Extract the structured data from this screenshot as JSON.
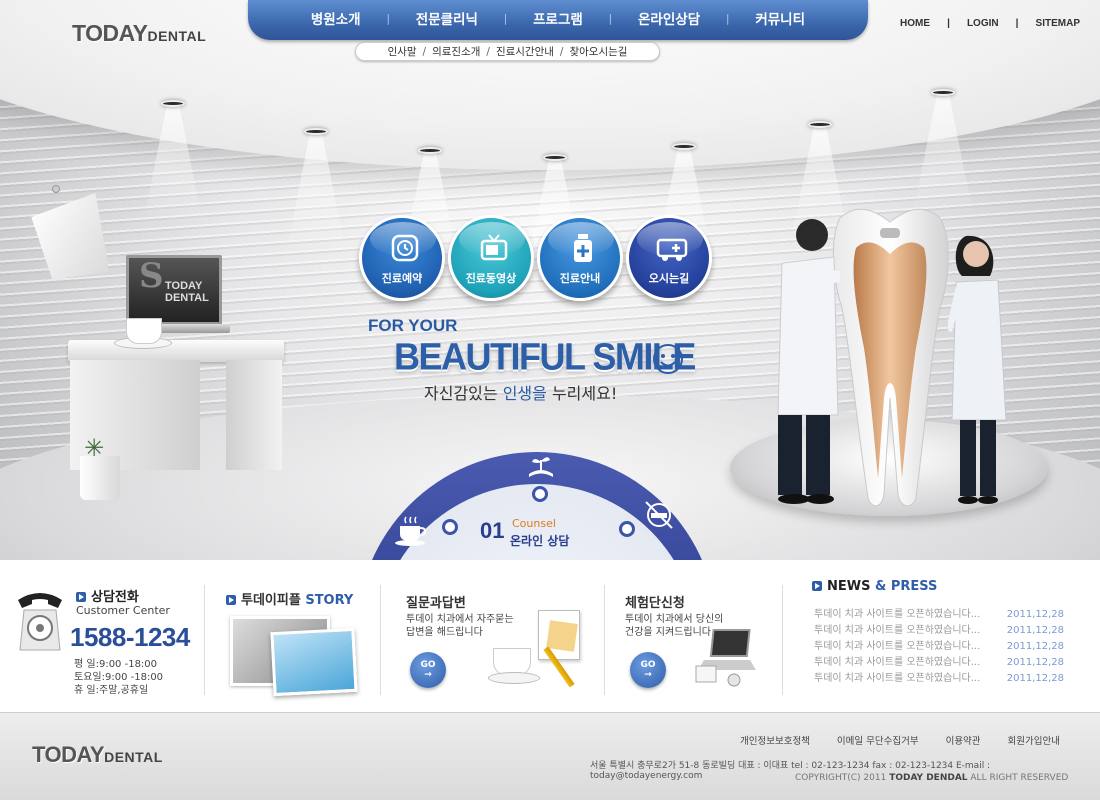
{
  "logo": {
    "today": "TODAY",
    "dental": "DENTAL"
  },
  "gnb": {
    "items": [
      "병원소개",
      "전문클리닉",
      "프로그램",
      "온라인상담",
      "커뮤니티"
    ]
  },
  "subnav": {
    "items": [
      "인사말",
      "의료진소개",
      "진료시간안내",
      "찾아오시는길"
    ]
  },
  "util": {
    "items": [
      "HOME",
      "LOGIN",
      "SITEMAP"
    ]
  },
  "hero": {
    "monitor_text": [
      "TODAY",
      "DENTAL"
    ],
    "circles": [
      {
        "label": "진료예약",
        "icon": "clock-icon",
        "color": "#1f5fb0"
      },
      {
        "label": "진료동영상",
        "icon": "tv-icon",
        "color": "#1da2b8"
      },
      {
        "label": "진료안내",
        "icon": "medicine-bottle-icon",
        "color": "#1f6fbc"
      },
      {
        "label": "오시는길",
        "icon": "ambulance-icon",
        "color": "#23409a"
      }
    ],
    "slogan_top": "FOR YOUR",
    "slogan_main": "BEAUTIFUL SMILE",
    "slogan_sub_a": "자신감있는 ",
    "slogan_sub_b": "인생을",
    "slogan_sub_c": "  누리세요!"
  },
  "counsel": {
    "number": "01",
    "label_en": "Counsel",
    "label_ko": "온라인 상담"
  },
  "info": {
    "phone": {
      "title": "상담전화",
      "sub": "Customer Center",
      "number": "1588-1234",
      "hours": [
        {
          "k": "평    일",
          "v": ":9:00 -18:00"
        },
        {
          "k": "토요일",
          "v": ":9:00 -18:00"
        },
        {
          "k": "휴    일",
          "v": ":주말,공휴일"
        }
      ]
    },
    "story": {
      "title_a": "투데이피플 ",
      "title_b": "STORY"
    },
    "qna": {
      "title": "질문과답변",
      "desc1": "투데이 치과에서 자주묻는",
      "desc2": "답변을 해드립니다",
      "go": "GO"
    },
    "trial": {
      "title": "체험단신청",
      "desc1": "투데이 치과에서 당신의",
      "desc2": "건강을 지켜드립니다.",
      "go": "GO"
    },
    "news": {
      "title_a": "NEWS",
      "title_b": " & PRESS",
      "rows": [
        {
          "t": "투데이 치과 사이트를 오픈하였습니다...",
          "d": "2011,12,28"
        },
        {
          "t": "투데이 치과 사이트를 오픈하였습니다...",
          "d": "2011,12,28"
        },
        {
          "t": "투데이 치과 사이트를 오픈하였습니다...",
          "d": "2011,12,28"
        },
        {
          "t": "투데이 치과 사이트를 오픈하였습니다...",
          "d": "2011,12,28"
        },
        {
          "t": "투데이 치과 사이트를 오픈하였습니다...",
          "d": "2011,12,28"
        }
      ]
    }
  },
  "footer": {
    "links": [
      "개인정보보호정책",
      "이메일 무단수집거부",
      "이용약관",
      "회원가입안내"
    ],
    "address": "서울 특별시 충무로2가 51-8 동로빌딩  대표 : 이대표   tel : 02-123-1234   fax : 02-123-1234     E-mail : today@todayenergy.com",
    "copy_a": "COPYRIGHT(C) 2011 ",
    "copy_b": "TODAY DENDAL",
    "copy_c": " ALL RIGHT RESERVED"
  }
}
